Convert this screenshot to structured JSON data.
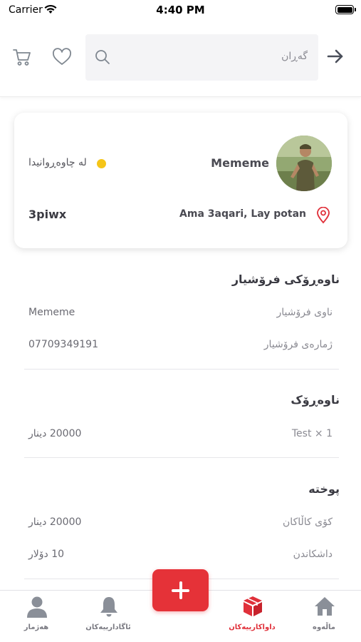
{
  "status_bar": {
    "carrier": "Carrier",
    "time": "4:40 PM"
  },
  "header": {
    "search_placeholder": "گەڕان",
    "icons": [
      "cart-icon",
      "heart-icon",
      "search-icon",
      "arrow-right-icon"
    ]
  },
  "profile": {
    "name": "Mememe",
    "status": "لە چاوەڕوانیدا",
    "status_color": "#f5c518",
    "code": "3piwx",
    "address": "Ama 3aqari, Lay potan",
    "pin_color": "#e0303a"
  },
  "seller_section": {
    "title": "ناوەڕۆکی فرۆشیار",
    "rows": [
      {
        "label": "ناوی فرۆشیار",
        "value": "Mememe"
      },
      {
        "label": "ژمارەی فرۆشیار",
        "value": "07709349191"
      }
    ]
  },
  "content_section": {
    "title": "ناوەڕۆک",
    "rows": [
      {
        "label": "1 × Test",
        "value": "20000 دینار"
      }
    ]
  },
  "summary_section": {
    "title": "پوختە",
    "rows": [
      {
        "label": "کۆی کاڵاکان",
        "value": "20000 دینار"
      },
      {
        "label": "داشکاندن",
        "value": "10 دۆلار"
      }
    ]
  },
  "bottom_nav": {
    "items": [
      {
        "label": "هەژمار",
        "icon": "person-icon"
      },
      {
        "label": "ئاگادارییەکان",
        "icon": "bell-icon"
      },
      {
        "label": "داواکارییەکان",
        "icon": "box-icon",
        "active": true
      },
      {
        "label": "ماڵەوە",
        "icon": "home-icon"
      }
    ],
    "fab_icon": "plus-icon",
    "accent": "#e53238"
  }
}
